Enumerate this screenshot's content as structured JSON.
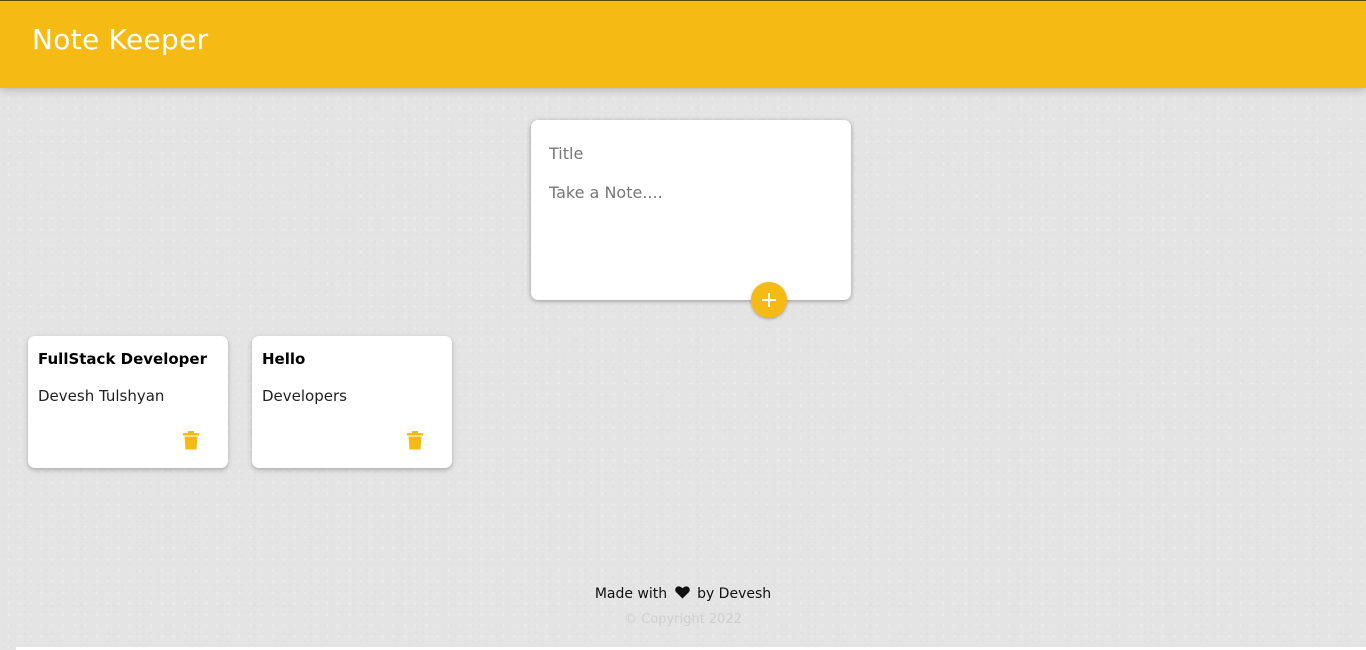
{
  "header": {
    "title": "Note Keeper"
  },
  "composer": {
    "title_placeholder": "Title",
    "content_placeholder": "Take a Note....",
    "add_icon": "plus-icon"
  },
  "notes": [
    {
      "title": "FullStack Developer",
      "content": "Devesh Tulshyan",
      "delete_icon": "trash-icon"
    },
    {
      "title": "Hello",
      "content": "Developers",
      "delete_icon": "trash-icon"
    }
  ],
  "footer": {
    "made_with": "Made with",
    "heart_icon": "heart-icon",
    "by": "by Devesh",
    "copyright": "© Copyright 2022"
  },
  "colors": {
    "accent": "#f5ba13",
    "background": "#e4e4e4",
    "card": "#ffffff"
  }
}
